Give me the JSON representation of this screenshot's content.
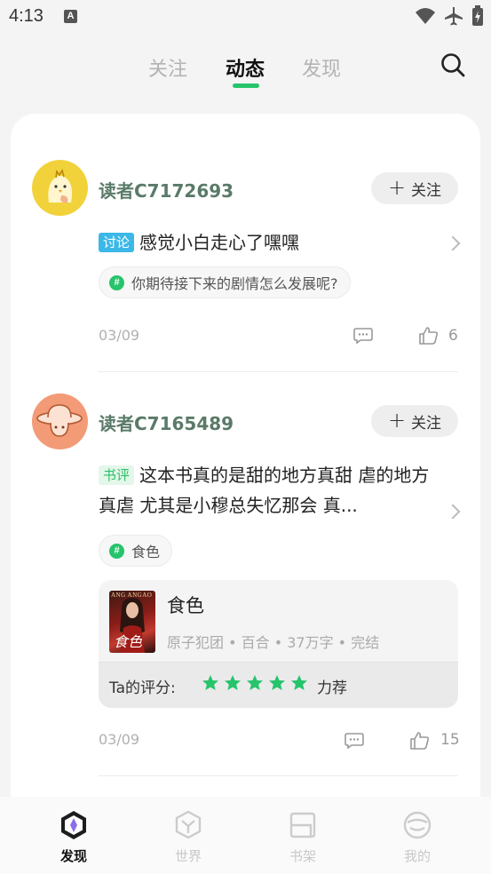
{
  "status_bar": {
    "time": "4:13",
    "a_label": "A"
  },
  "top_tabs": {
    "items": [
      "关注",
      "动态",
      "发现"
    ],
    "active": "动态"
  },
  "follow_label": "关注",
  "posts": [
    {
      "username": "读者C7172693",
      "tag": "讨论",
      "text": "感觉小白走心了嘿嘿",
      "topic": "你期待接下来的剧情怎么发展呢?",
      "date": "03/09",
      "likes": "6"
    },
    {
      "username": "读者C7165489",
      "tag": "书评",
      "text": "这本书真的是甜的地方真甜 虐的地方真虐 尤其是小穆总失忆那会 真...",
      "topic": "食色",
      "date": "03/09",
      "likes": "15",
      "book": {
        "title": "食色",
        "meta": "原子犯团 • 百合 • 37万字 • 完结",
        "cover_text": "食色",
        "cover_top": "ANG ANGAO",
        "rating_label": "Ta的评分:",
        "stars": 5,
        "rating_word": "力荐"
      }
    }
  ],
  "bottom_nav": {
    "items": [
      {
        "label": "发现",
        "icon": "discover-icon",
        "active": true
      },
      {
        "label": "世界",
        "icon": "world-icon",
        "active": false
      },
      {
        "label": "书架",
        "icon": "bookshelf-icon",
        "active": false
      },
      {
        "label": "我的",
        "icon": "profile-icon",
        "active": false
      }
    ]
  },
  "colors": {
    "accent": "#26c46b",
    "discuss_tag": "#3bb8e8",
    "username": "#5a7a68"
  }
}
